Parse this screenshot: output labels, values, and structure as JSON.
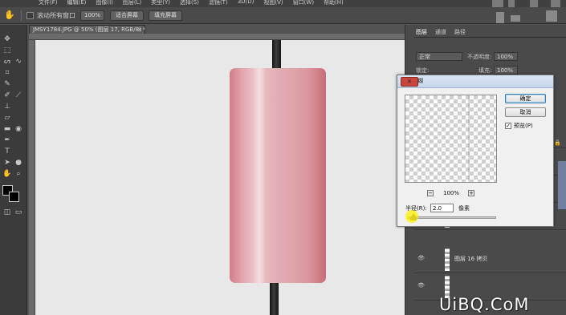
{
  "menu": {
    "items": [
      "文件(F)",
      "编辑(E)",
      "图像(I)",
      "图层(L)",
      "类型(Y)",
      "选择(S)",
      "滤镜(T)",
      "3D(D)",
      "视图(V)",
      "窗口(W)",
      "帮助(H)"
    ]
  },
  "options_bar": {
    "scroll_all_label": "滚动所有窗口",
    "zoom_100_label": "100%",
    "fit_screen_label": "适合屏幕",
    "fill_screen_label": "填充屏幕"
  },
  "document": {
    "tab_title": "JMSY1784.JPG @ 50% (图层 17, RGB/8) *",
    "close_glyph": "×"
  },
  "panels": {
    "tabs": [
      "图层",
      "通道",
      "路径"
    ],
    "blend_mode": "正常",
    "opacity_label": "不透明度:",
    "opacity_value": "100%",
    "lock_label": "锁定:",
    "fill_label": "填充:",
    "fill_value": "100%",
    "layer_name": "图层 16 拷贝"
  },
  "dialog": {
    "title": "高斯模糊",
    "ok_label": "确定",
    "cancel_label": "取消",
    "preview_label": "预览(P)",
    "preview_checked": true,
    "zoom_value": "100%",
    "radius_label": "半径(R):",
    "radius_value": "2.0",
    "radius_unit": "像素",
    "close_glyph": "✕",
    "minus_glyph": "−",
    "plus_glyph": "+"
  },
  "colors": {
    "foreground": "#000000",
    "background": "#000000",
    "cylinder": "#dea3aa"
  },
  "icons": [
    "hand-icon",
    "move-icon",
    "marquee-icon",
    "lasso-icon",
    "crop-icon",
    "eyedropper-icon",
    "brush-icon",
    "stamp-icon",
    "eraser-icon",
    "gradient-icon",
    "pen-icon",
    "type-icon",
    "selection-icon",
    "ellipse-icon",
    "zoom-icon",
    "eye-icon",
    "lock-icon"
  ],
  "watermark": "UiBQ.CoM"
}
